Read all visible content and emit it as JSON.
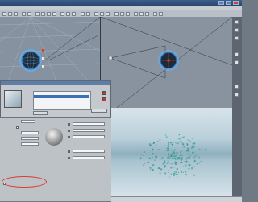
{
  "window": {
    "title": ""
  },
  "menu": {
    "items": [
      "",
      "",
      "",
      "",
      "",
      "",
      "",
      ""
    ]
  },
  "viewports": {
    "top_left_label": "",
    "top_right_label": ""
  },
  "material_editor": {
    "title": "",
    "list_rows": [
      "",
      "",
      ""
    ]
  },
  "properties": {
    "rows": [
      "",
      "",
      "",
      "",
      "",
      "",
      "",
      "",
      "",
      ""
    ]
  },
  "render": {
    "title": ""
  },
  "colors": {
    "accent": "#2f7fd0",
    "selection_glow": "#4fb6ff",
    "highlight_red": "#e03a2f",
    "render_particles": "#2f9b93"
  }
}
